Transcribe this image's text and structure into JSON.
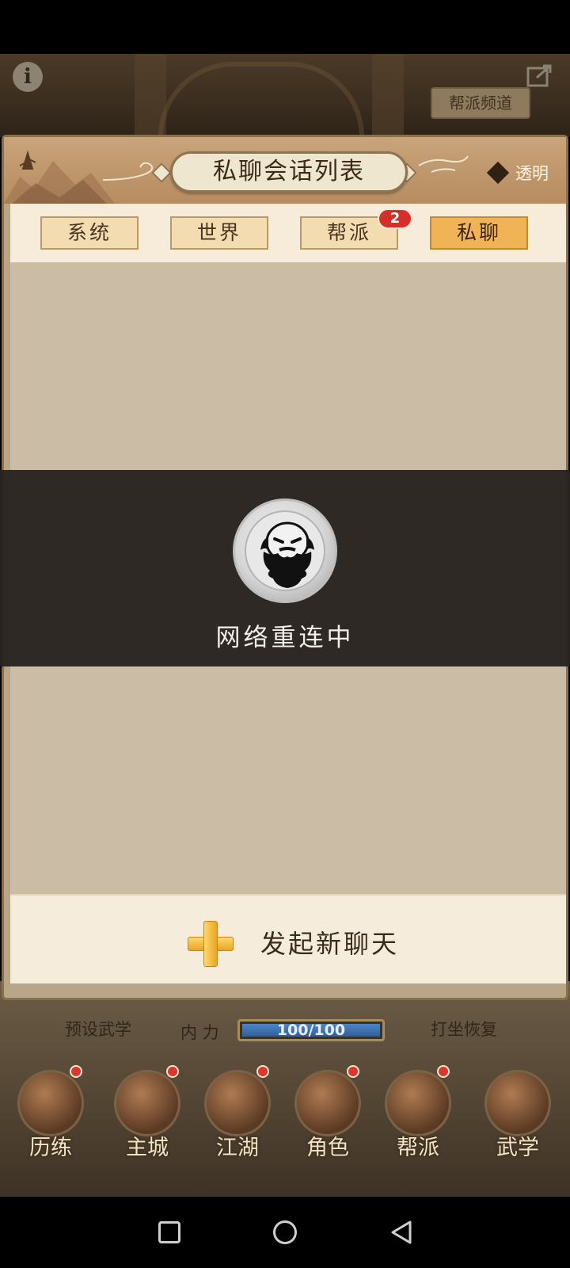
{
  "background": {
    "guild_channel_label": "帮派频道",
    "stats": {
      "preset_martial_label": "预设武学",
      "neili_label": "内 力",
      "neili_value": "100/100",
      "neili_fraction": 1.0,
      "meditate_label": "打坐恢复"
    },
    "bottom_nav": [
      {
        "label": "历练"
      },
      {
        "label": "主城"
      },
      {
        "label": "江湖"
      },
      {
        "label": "角色"
      },
      {
        "label": "帮派"
      },
      {
        "label": "武学"
      }
    ]
  },
  "panel": {
    "title": "私聊会话列表",
    "transparent_label": "透明",
    "tabs": [
      {
        "label": "系统",
        "active": false
      },
      {
        "label": "世界",
        "active": false
      },
      {
        "label": "帮派",
        "active": false
      },
      {
        "label": "私聊",
        "active": true
      }
    ],
    "guild_tab_badge": "2",
    "new_chat_label": "发起新聊天"
  },
  "overlay": {
    "message": "网络重连中"
  },
  "colors": {
    "active_tab": "#f0b456",
    "inactive_tab": "#f3ddb0",
    "badge": "#d62f2a",
    "overlay": "#28241f"
  }
}
